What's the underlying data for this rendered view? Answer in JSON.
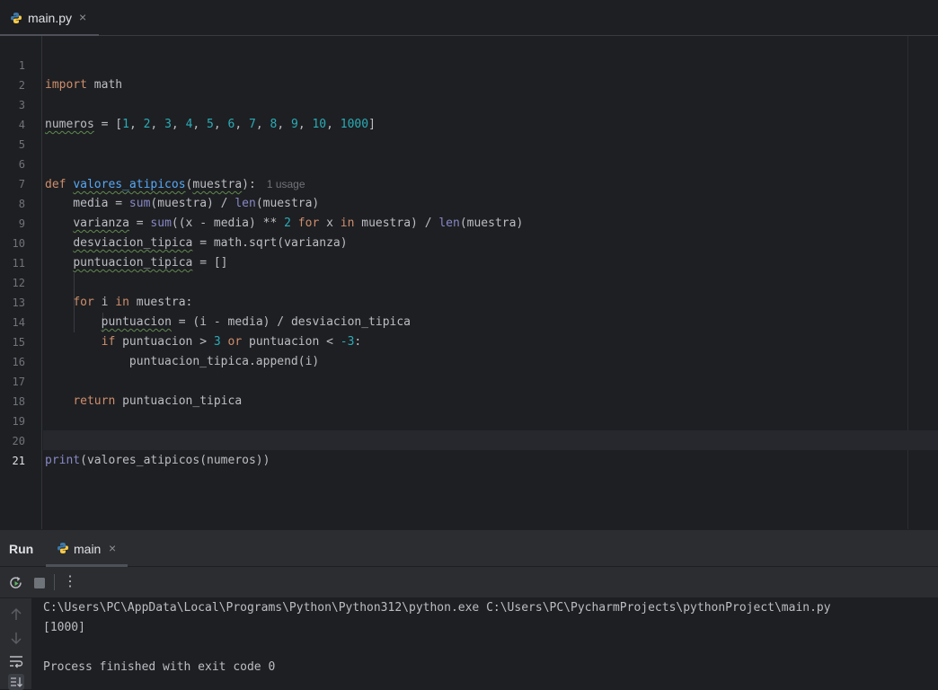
{
  "editor_tab": {
    "filename": "main.py",
    "close_glyph": "×",
    "icon": "python-file-icon"
  },
  "editor": {
    "usage_hint": "1 usage",
    "current_line": 21,
    "line_numbers": [
      "1",
      "2",
      "3",
      "4",
      "5",
      "6",
      "7",
      "8",
      "9",
      "10",
      "11",
      "12",
      "13",
      "14",
      "15",
      "16",
      "17",
      "18",
      "19",
      "20",
      "21"
    ],
    "code": {
      "l1_kw": "import",
      "l1_rest": " math",
      "l3_var": "numeros",
      "l3_a": " = [",
      "l3_n1": "1",
      "l3_n2": "2",
      "l3_n3": "3",
      "l3_n4": "4",
      "l3_n5": "5",
      "l3_n6": "6",
      "l3_n7": "7",
      "l3_n8": "8",
      "l3_n9": "9",
      "l3_n10": "10",
      "l3_n11": "1000",
      "l3_sep": ", ",
      "l3_end": "]",
      "l6_kw": "def",
      "l6_fn": "valores_atipicos",
      "l6_p1": "(",
      "l6_param": "muestra",
      "l6_p2": "):",
      "l7_a": "    media = ",
      "l7_sum": "sum",
      "l7_b": "(muestra) / ",
      "l7_len": "len",
      "l7_c": "(muestra)",
      "l8_indent": "    ",
      "l8_var": "varianza",
      "l8_a": " = ",
      "l8_sum": "sum",
      "l8_b": "((x - media) ** ",
      "l8_n": "2",
      "l8_sp": " ",
      "l8_for": "for",
      "l8_c": " x ",
      "l8_in": "in",
      "l8_d": " muestra) / ",
      "l8_len": "len",
      "l8_e": "(muestra)",
      "l9_indent": "    ",
      "l9_var": "desviacion_tipica",
      "l9_a": " = math.sqrt(varianza)",
      "l10_indent": "    ",
      "l10_var": "puntuacion_tipica",
      "l10_a": " = []",
      "l12_indent": "    ",
      "l12_for": "for",
      "l12_a": " i ",
      "l12_in": "in",
      "l12_b": " muestra:",
      "l13_indent": "        ",
      "l13_var": "puntuacion",
      "l13_a": " = (i - media) / desviacion_tipica",
      "l14_indent": "        ",
      "l14_if": "if",
      "l14_a": " puntuacion > ",
      "l14_n1": "3",
      "l14_sp": " ",
      "l14_or": "or",
      "l14_b": " puntuacion < ",
      "l14_n2": "-3",
      "l14_c": ":",
      "l15": "            puntuacion_tipica.append(i)",
      "l17_indent": "    ",
      "l17_kw": "return",
      "l17_a": " puntuacion_tipica",
      "l20_print": "print",
      "l20_a": "(valores_atipicos(numeros))"
    }
  },
  "run_panel": {
    "title": "Run",
    "tab_label": "main",
    "close_glyph": "×",
    "more_glyph": "⋮",
    "output": [
      "C:\\Users\\PC\\AppData\\Local\\Programs\\Python\\Python312\\python.exe C:\\Users\\PC\\PycharmProjects\\pythonProject\\main.py",
      "[1000]",
      "",
      "Process finished with exit code 0"
    ]
  },
  "colors": {
    "background": "#1e1f22",
    "panel": "#2b2d30",
    "keyword": "#cf8e6d",
    "number": "#2aacb8",
    "function": "#56a8f5",
    "builtin": "#8888c6",
    "text": "#bcbec4"
  }
}
